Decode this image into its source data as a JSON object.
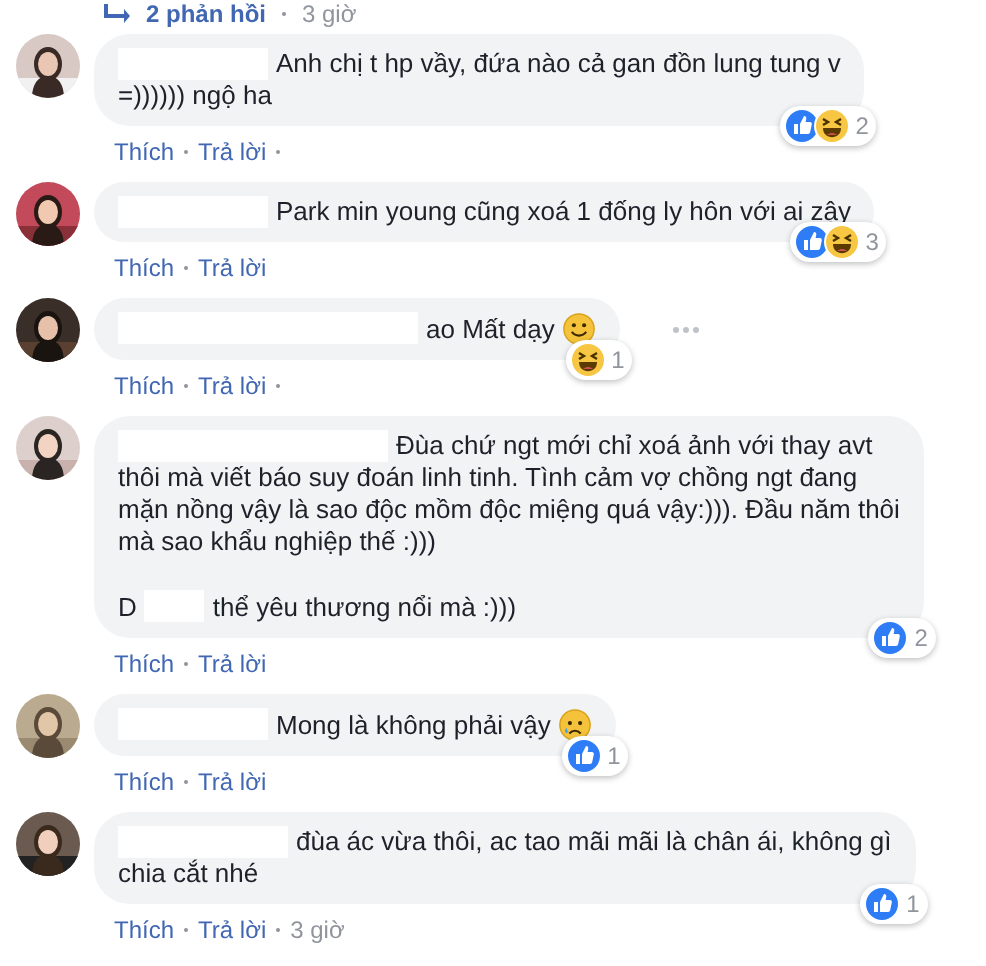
{
  "replies_bar": {
    "label": "2 phản hồi",
    "time": "3 giờ"
  },
  "comments": [
    {
      "body": [
        {
          "kind": "redacted"
        },
        {
          "kind": "text",
          "text": "Anh chị t hp vầy, đứa nào cả gan đồn lung tung v"
        },
        {
          "kind": "text",
          "text": "=)))))) ngộ ha"
        }
      ],
      "reactions": [
        {
          "kind": "like"
        },
        {
          "kind": "haha"
        }
      ],
      "reaction_count": "2",
      "actions": [
        "Thích",
        "Trả lời"
      ],
      "trailing_separator": true,
      "more_menu": false
    },
    {
      "body": [
        {
          "kind": "redacted"
        },
        {
          "kind": "text",
          "text": "Park min young cũng xoá 1 đống ly hôn với ai zậy"
        }
      ],
      "reactions": [
        {
          "kind": "like"
        },
        {
          "kind": "haha"
        }
      ],
      "reaction_count": "3",
      "actions": [
        "Thích",
        "Trả lời"
      ],
      "trailing_separator": false,
      "more_menu": false
    },
    {
      "body": [
        {
          "kind": "redacted"
        },
        {
          "kind": "text",
          "text": "ao Mất dạy"
        },
        {
          "kind": "smile"
        }
      ],
      "reactions": [
        {
          "kind": "haha"
        }
      ],
      "reaction_count": "1",
      "actions": [
        "Thích",
        "Trả lời"
      ],
      "trailing_separator": true,
      "more_menu": true
    },
    {
      "body": [
        {
          "kind": "redacted"
        },
        {
          "kind": "text",
          "text": "Đùa chứ ngt mới chỉ xoá ảnh với thay avt"
        },
        {
          "kind": "text",
          "text": "thôi mà viết báo suy đoán linh tinh. Tình cảm vợ chồng ngt đang\nmặn nồng vậy là sao độc mồm độc miệng quá vậy:))). Đầu năm thôi\nmà sao khẩu nghiệp thế :)))"
        },
        {
          "kind": "text",
          "text": "D"
        },
        {
          "kind": "redacted"
        },
        {
          "kind": "text",
          "text": "thể yêu thương nổi mà :)))"
        }
      ],
      "reactions": [
        {
          "kind": "like"
        }
      ],
      "reaction_count": "2",
      "actions": [
        "Thích",
        "Trả lời"
      ],
      "trailing_separator": false,
      "more_menu": false
    },
    {
      "body": [
        {
          "kind": "redacted"
        },
        {
          "kind": "text",
          "text": "Mong là không phải vậy"
        },
        {
          "kind": "cry"
        }
      ],
      "reactions": [
        {
          "kind": "like"
        }
      ],
      "reaction_count": "1",
      "actions": [
        "Thích",
        "Trả lời"
      ],
      "trailing_separator": false,
      "more_menu": false
    },
    {
      "body": [
        {
          "kind": "redacted"
        },
        {
          "kind": "text",
          "text": "đùa ác vừa thôi, ac tao mãi mãi là chân ái, không gì"
        },
        {
          "kind": "text",
          "text": "chia cắt nhé"
        }
      ],
      "reactions": [
        {
          "kind": "like"
        }
      ],
      "reaction_count": "1",
      "actions": [
        "Thích",
        "Trả lời"
      ],
      "time": "3 giờ",
      "trailing_separator": false,
      "more_menu": false
    }
  ]
}
